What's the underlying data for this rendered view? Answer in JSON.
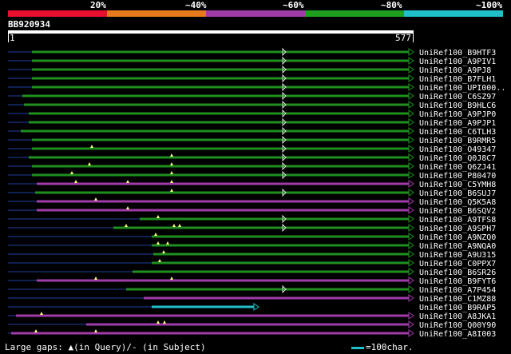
{
  "scale": {
    "labels": [
      "20%",
      "~40%",
      "~60%",
      "~80%",
      "~100%"
    ],
    "colors": [
      "#e8102e",
      "#e87a1e",
      "#a03ca8",
      "#1ea01e",
      "#1fc0c8"
    ]
  },
  "query": {
    "id": "BB920934",
    "start": "1",
    "end": "577"
  },
  "colors": {
    "line": "#1f8f1f",
    "line_purple": "#a03ca8",
    "line_teal": "#1fc0c8",
    "gap": "#1f3fa0",
    "marker": "#ffff88"
  },
  "hits": [
    {
      "label": "UniRef100_B9HTF3",
      "color": "green"
    },
    {
      "label": "UniRef100_A9PIV1",
      "color": "green"
    },
    {
      "label": "UniRef100_A9PJ8",
      "color": "green"
    },
    {
      "label": "UniRef100_B7FLH1",
      "color": "green"
    },
    {
      "label": "UniRef100_UPI000..",
      "color": "green"
    },
    {
      "label": "UniRef100_C6SZ97",
      "color": "green"
    },
    {
      "label": "UniRef100_B9HLC6",
      "color": "green"
    },
    {
      "label": "UniRef100_A9PJP0",
      "color": "green"
    },
    {
      "label": "UniRef100_A9PJP1",
      "color": "green"
    },
    {
      "label": "UniRef100_C6TLH3",
      "color": "green"
    },
    {
      "label": "UniRef100_B9RMR5",
      "color": "green"
    },
    {
      "label": "UniRef100_O49347",
      "color": "green"
    },
    {
      "label": "UniRef100_Q0J8C7",
      "color": "green"
    },
    {
      "label": "UniRef100_Q6ZJ41",
      "color": "green"
    },
    {
      "label": "UniRef100_P80470",
      "color": "green"
    },
    {
      "label": "UniRef100_C5YMH8",
      "color": "purple"
    },
    {
      "label": "UniRef100_B6SUJ7",
      "color": "green"
    },
    {
      "label": "UniRef100_Q5K5A8",
      "color": "purple"
    },
    {
      "label": "UniRef100_B6SQV2",
      "color": "purple"
    },
    {
      "label": "UniRef100_A9TFS8",
      "color": "green"
    },
    {
      "label": "UniRef100_A9SPH7",
      "color": "green"
    },
    {
      "label": "UniRef100_A9NZQ0",
      "color": "green"
    },
    {
      "label": "UniRef100_A9NQA0",
      "color": "green"
    },
    {
      "label": "UniRef100_A9U315",
      "color": "green"
    },
    {
      "label": "UniRef100_C0PPX7",
      "color": "green"
    },
    {
      "label": "UniRef100_B6SR26",
      "color": "green"
    },
    {
      "label": "UniRef100_B9FYT6",
      "color": "purple"
    },
    {
      "label": "UniRef100_A7P454",
      "color": "green"
    },
    {
      "label": "UniRef100_C1MZ88",
      "color": "purple"
    },
    {
      "label": "UniRef100_B9RAP5",
      "color": "teal"
    },
    {
      "label": "UniRef100_A8JKA1",
      "color": "purple"
    },
    {
      "label": "UniRef100_Q00Y90",
      "color": "purple"
    },
    {
      "label": "UniRef100_A8I003",
      "color": "purple"
    }
  ],
  "footer": {
    "gaps_text": "Large gaps: ▲(in Query)/- (in Subject)",
    "scale_text": "=100char."
  }
}
